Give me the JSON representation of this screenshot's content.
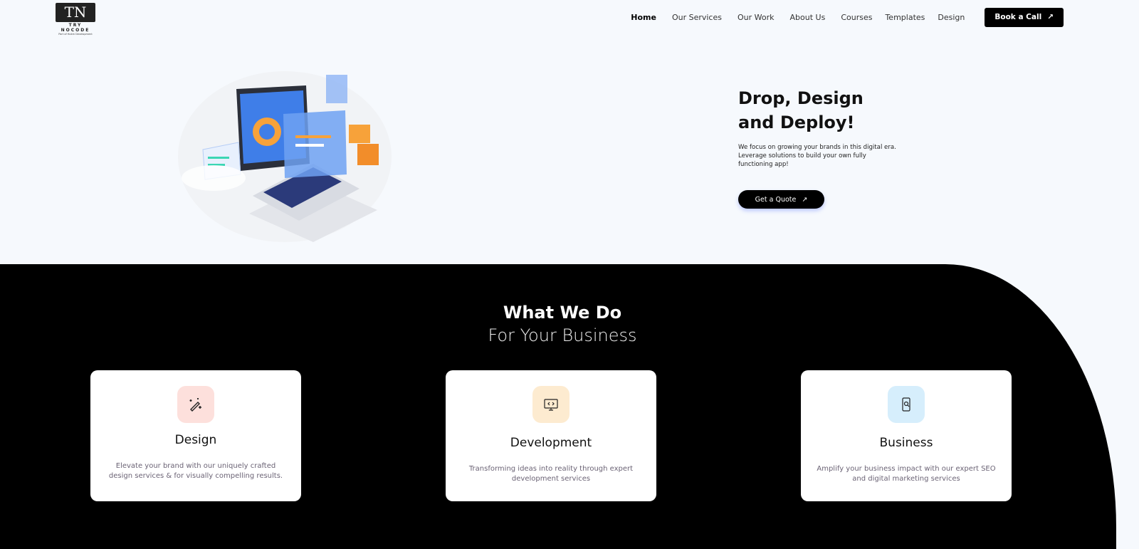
{
  "logo": {
    "mark": "TN",
    "name": "TRY NOCODE",
    "tagline": "Part of Hokm Development"
  },
  "nav": {
    "items": [
      {
        "label": "Home",
        "active": true
      },
      {
        "label": "Our Services"
      },
      {
        "label": "Our Work"
      },
      {
        "label": "About Us"
      },
      {
        "label": "Courses"
      },
      {
        "label": "Templates"
      },
      {
        "label": "Design"
      }
    ],
    "cta": "Book a Call",
    "cta_icon": "arrow-up-right-icon"
  },
  "hero": {
    "title_line1": "Drop, Design",
    "title_line2": "and Deploy!",
    "description": "We focus on growing your brands in this digital era. Leverage solutions to build your own fully functioning app!",
    "cta": "Get a Quote"
  },
  "services": {
    "title": "What We Do",
    "subtitle": "For Your Business",
    "cards": [
      {
        "title": "Design",
        "description": "Elevate your brand with our uniquely crafted design services & for visually compelling results.",
        "icon": "magic-wand-icon",
        "icon_bg": "#fde0dc"
      },
      {
        "title": "Development",
        "description": "Transforming ideas into reality through expert development services",
        "icon": "code-monitor-icon",
        "icon_bg": "#fdebd0"
      },
      {
        "title": "Business",
        "description": "Amplify your business impact with our expert SEO and digital marketing services",
        "icon": "mobile-search-icon",
        "icon_bg": "#d6eefc"
      }
    ]
  }
}
